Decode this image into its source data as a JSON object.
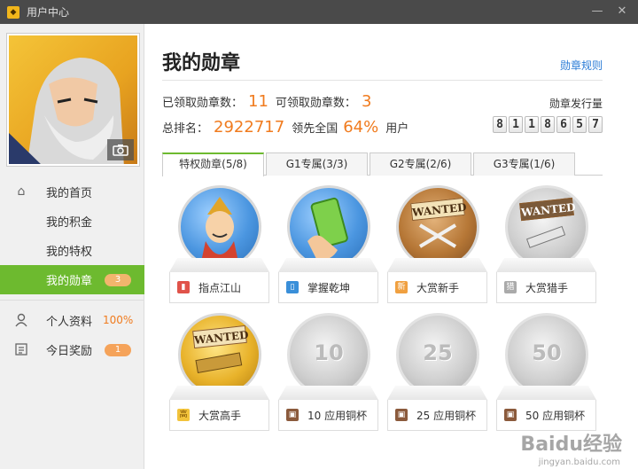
{
  "window": {
    "title": "用户中心"
  },
  "sidebar": {
    "items": [
      {
        "label": "我的首页",
        "icon": "home-icon"
      },
      {
        "label": "我的积金"
      },
      {
        "label": "我的特权"
      },
      {
        "label": "我的勋章",
        "badge": "3",
        "active": true
      },
      {
        "label": "个人资料",
        "icon": "user-icon",
        "extra": "100%"
      },
      {
        "label": "今日奖励",
        "icon": "list-icon",
        "badge": "1"
      }
    ]
  },
  "main": {
    "title": "我的勋章",
    "rules_link": "勋章规则",
    "stats": {
      "received_label": "已领取勋章数：",
      "received_value": "11",
      "claimable_label": "可领取勋章数：",
      "claimable_value": "3",
      "rank_label": "总排名：",
      "rank_value": "2922717",
      "lead_label": "领先全国",
      "lead_value": "64%",
      "lead_suffix": "用户",
      "issue_label": "勋章发行量",
      "issue_digits": [
        "8",
        "1",
        "1",
        "8",
        "6",
        "5",
        "7"
      ]
    },
    "tabs": [
      {
        "label": "特权勋章(5/8)",
        "active": true
      },
      {
        "label": "G1专属(3/3)"
      },
      {
        "label": "G2专属(2/6)"
      },
      {
        "label": "G3专属(1/6)"
      }
    ],
    "badges": [
      {
        "label": "指点江山",
        "icon_char": "▮",
        "medal": "blue"
      },
      {
        "label": "掌握乾坤",
        "icon_char": "▯",
        "medal": "blue"
      },
      {
        "label": "大赏新手",
        "icon_char": "新",
        "medal": "brown",
        "wanted": "WANTED"
      },
      {
        "label": "大赏猎手",
        "icon_char": "猎",
        "medal": "silver",
        "wanted": "WANTED"
      },
      {
        "label": "大赏高手",
        "icon_char": "高",
        "medal": "gold",
        "wanted": "WANTED"
      },
      {
        "label": "10 应用铜杯",
        "icon_char": "▣",
        "medal": "silver",
        "num": "10"
      },
      {
        "label": "25 应用铜杯",
        "icon_char": "▣",
        "medal": "silver",
        "num": "25"
      },
      {
        "label": "50 应用铜杯",
        "icon_char": "▣",
        "medal": "silver",
        "num": "50"
      }
    ]
  },
  "watermark": {
    "text": "Baidu经验",
    "sub": "jingyan.baidu.com"
  }
}
